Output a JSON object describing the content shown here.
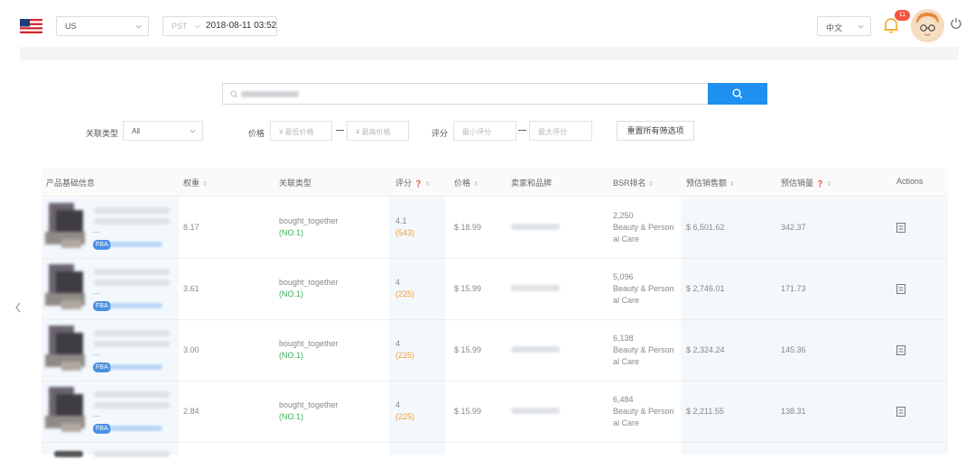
{
  "header": {
    "marketplace": "US",
    "timezone": "PST",
    "datetime": "2018-08-11 03:52",
    "language": "中文",
    "notification_count": "11"
  },
  "search": {
    "placeholder": ""
  },
  "filters": {
    "relation_label": "关联类型",
    "relation_value": "All",
    "price_label": "价格",
    "price_min_placeholder": "¥ 最低价格",
    "price_max_placeholder": "¥ 最高价格",
    "rating_label": "评分",
    "rating_min_placeholder": "最小评分",
    "rating_max_placeholder": "最大评分",
    "reset_label": "重置所有筛选项"
  },
  "table": {
    "columns": [
      "产品基础信息",
      "权重",
      "关联类型",
      "评分",
      "价格",
      "卖家和品牌",
      "BSR排名",
      "预估销售额",
      "预估销量",
      "Actions"
    ],
    "rows": [
      {
        "weight": "8.17",
        "relation": "bought_together",
        "relation_rank": "(NO.1)",
        "rating": "4.1",
        "reviews": "(543)",
        "price": "$ 18.99",
        "bsr_rank": "2,250",
        "bsr_category_1": "Beauty & Person",
        "bsr_category_2": "al Care",
        "sales": "$ 6,501.62",
        "units": "342.37",
        "dots": "...",
        "fba": "FBA"
      },
      {
        "weight": "3.61",
        "relation": "bought_together",
        "relation_rank": "(NO.1)",
        "rating": "4",
        "reviews": "(225)",
        "price": "$ 15.99",
        "bsr_rank": "5,096",
        "bsr_category_1": "Beauty & Person",
        "bsr_category_2": "al Care",
        "sales": "$ 2,746.01",
        "units": "171.73",
        "dots": "...",
        "fba": "FBA"
      },
      {
        "weight": "3.00",
        "relation": "bought_together",
        "relation_rank": "(NO.1)",
        "rating": "4",
        "reviews": "(225)",
        "price": "$ 15.99",
        "bsr_rank": "6,138",
        "bsr_category_1": "Beauty & Person",
        "bsr_category_2": "al Care",
        "sales": "$ 2,324.24",
        "units": "145.36",
        "dots": "...",
        "fba": "FBA"
      },
      {
        "weight": "2.84",
        "relation": "bought_together",
        "relation_rank": "(NO.1)",
        "rating": "4",
        "reviews": "(225)",
        "price": "$ 15.99",
        "bsr_rank": "6,484",
        "bsr_category_1": "Beauty & Person",
        "bsr_category_2": "al Care",
        "sales": "$ 2,211.55",
        "units": "138.31",
        "dots": "...",
        "fba": "FBA"
      }
    ]
  },
  "colors": {
    "accent": "#1e90f0",
    "relation_rank": "#3faf5f",
    "review_count": "#f0a030",
    "badge": "#f5543d"
  },
  "icons": [
    "us-flag-icon",
    "chevron-down-icon",
    "bell-icon",
    "avatar",
    "power-icon",
    "search-icon",
    "sort-icon",
    "help-icon",
    "list-icon",
    "chevron-left-icon"
  ]
}
